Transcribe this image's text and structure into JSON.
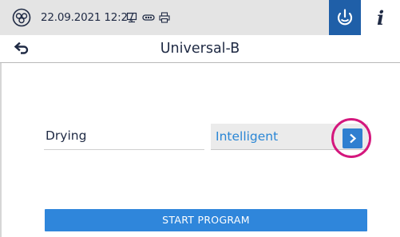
{
  "status_bar": {
    "datetime": "22.09.2021 12:27",
    "icons": [
      "logo-icon",
      "monitor-icon",
      "network-icon",
      "printer-icon",
      "program-icon",
      "info-icon"
    ],
    "info_label": "i"
  },
  "title_bar": {
    "title": "Universal-B",
    "back_icon": "back-arrow-icon"
  },
  "setting": {
    "label": "Drying",
    "value": "Intelligent"
  },
  "actions": {
    "start_label": "START PROGRAM"
  },
  "colors": {
    "primary_blue": "#2f86db",
    "dark_blue": "#1f5fa8",
    "text_dark": "#1f2a44",
    "value_text": "#2a86d5",
    "highlight": "#d4177d",
    "status_bg": "#e4e4e4"
  }
}
